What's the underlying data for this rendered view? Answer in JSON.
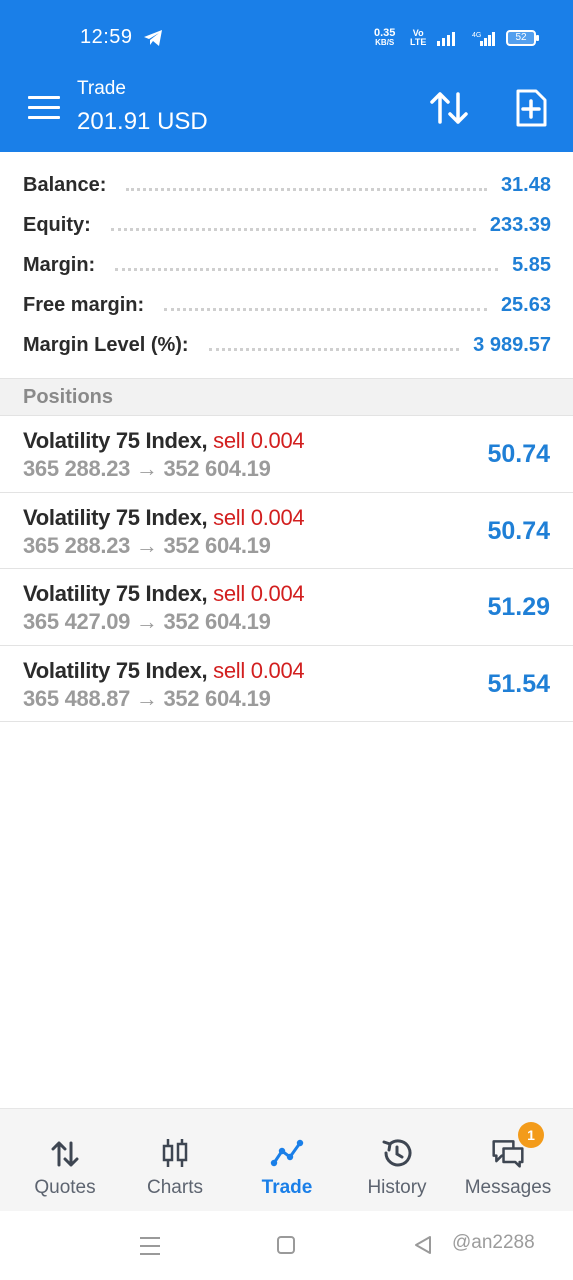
{
  "status_bar": {
    "time": "12:59",
    "net_speed": "0.35",
    "net_speed_unit": "KB/S",
    "volte": "Vo",
    "volte_sub": "LTE",
    "network": "4G",
    "battery": "52"
  },
  "app_bar": {
    "title": "Trade",
    "subtitle": "201.91 USD"
  },
  "summary": [
    {
      "label": "Balance:",
      "value": "31.48"
    },
    {
      "label": "Equity:",
      "value": "233.39"
    },
    {
      "label": "Margin:",
      "value": "5.85"
    },
    {
      "label": "Free margin:",
      "value": "25.63"
    },
    {
      "label": "Margin Level (%):",
      "value": "3 989.57"
    }
  ],
  "positions_header": "Positions",
  "positions": [
    {
      "symbol": "Volatility 75 Index,",
      "type": "sell 0.004",
      "open_price": "365 288.23",
      "arrow": "→",
      "current_price": "352 604.19",
      "profit": "50.74"
    },
    {
      "symbol": "Volatility 75 Index,",
      "type": "sell 0.004",
      "open_price": "365 288.23",
      "arrow": "→",
      "current_price": "352 604.19",
      "profit": "50.74"
    },
    {
      "symbol": "Volatility 75 Index,",
      "type": "sell 0.004",
      "open_price": "365 427.09",
      "arrow": "→",
      "current_price": "352 604.19",
      "profit": "51.29"
    },
    {
      "symbol": "Volatility 75 Index,",
      "type": "sell 0.004",
      "open_price": "365 488.87",
      "arrow": "→",
      "current_price": "352 604.19",
      "profit": "51.54"
    }
  ],
  "bottom_nav": {
    "items": [
      {
        "label": "Quotes",
        "icon": "quotes-icon"
      },
      {
        "label": "Charts",
        "icon": "charts-icon"
      },
      {
        "label": "Trade",
        "icon": "trade-icon",
        "active": true
      },
      {
        "label": "History",
        "icon": "history-icon"
      },
      {
        "label": "Messages",
        "icon": "messages-icon"
      }
    ],
    "messages_badge": "1"
  },
  "watermark": "@an2288",
  "colors": {
    "primary": "#1a7fe8",
    "value_blue": "#1f7fd6",
    "sell_red": "#d21f1f",
    "badge_orange": "#f39b1a"
  }
}
